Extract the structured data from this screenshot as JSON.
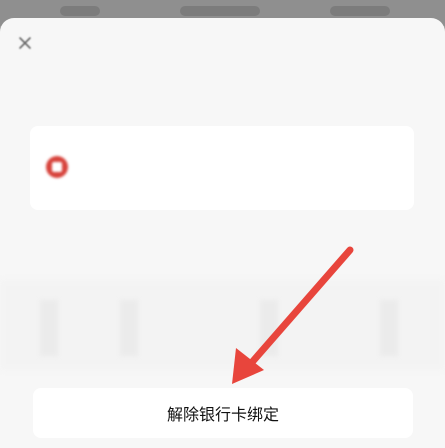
{
  "sheet": {
    "title": "",
    "close_icon": "close-icon"
  },
  "bank_card": {
    "bank_name": "",
    "card_number": "",
    "logo_color": "#d7423b"
  },
  "info_text": "",
  "action": {
    "unbind_label": "解除银行卡绑定"
  },
  "annotation": {
    "color": "#e8453c",
    "icon": "red-arrow-pointing-to-unbind-button"
  }
}
